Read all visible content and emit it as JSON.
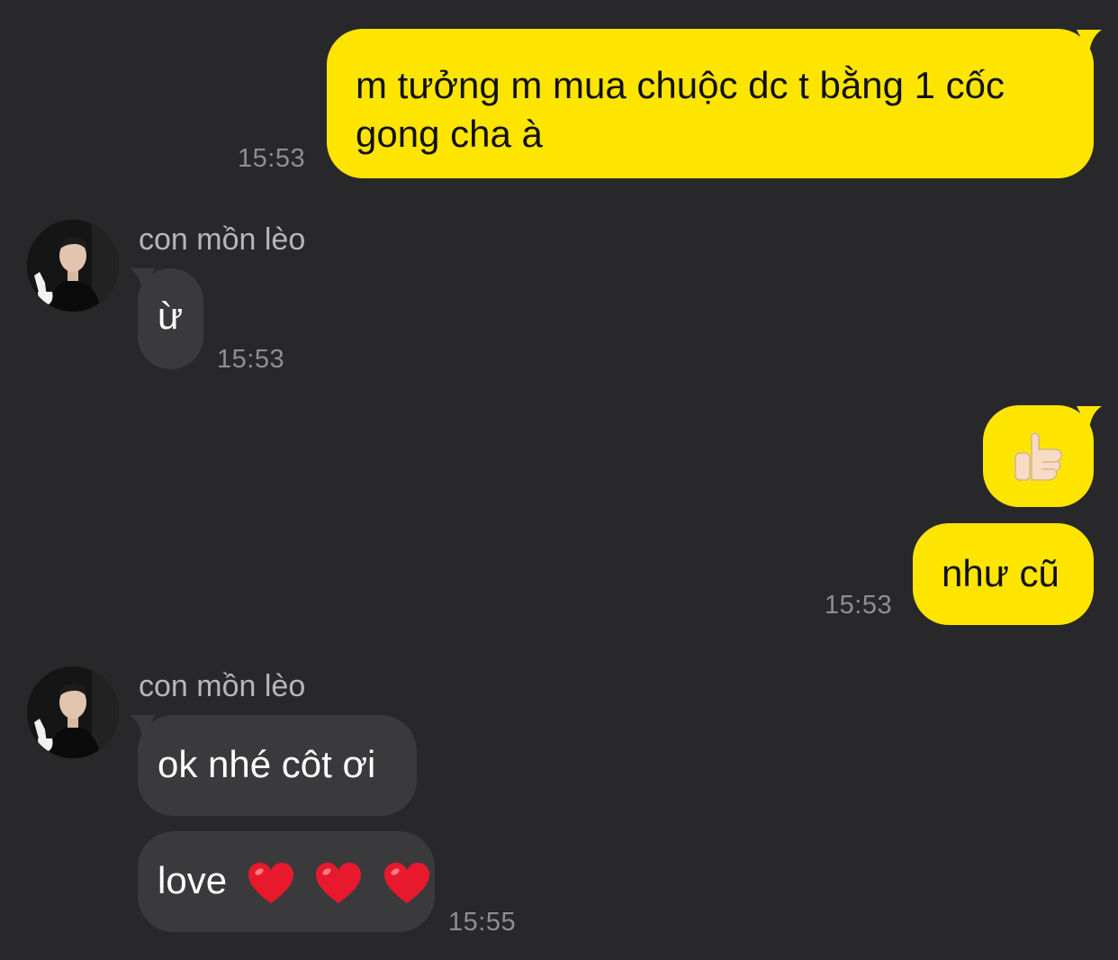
{
  "colors": {
    "background": "#28282a",
    "my_bubble": "#fee500",
    "their_bubble": "#3a3a3c",
    "time_text": "#8e8e93",
    "heart": "#e8192c"
  },
  "messages": {
    "m1": {
      "text": "m tưởng m mua chuộc dc t bằng 1 cốc gong cha à",
      "time": "15:53"
    },
    "sender1": {
      "name": "con mồn lèo",
      "avatar_icon": "user-avatar-icon"
    },
    "m2": {
      "text": "ừ",
      "time": "15:53"
    },
    "m3": {
      "emoji": "👍🏻",
      "icon": "thumbs-up-icon"
    },
    "m4": {
      "text": "như cũ",
      "time": "15:53"
    },
    "sender2": {
      "name": "con mồn lèo",
      "avatar_icon": "user-avatar-icon"
    },
    "m5": {
      "text": "ok nhé côt ơi"
    },
    "m6": {
      "text": "love",
      "emoji_icons": [
        "heart-icon",
        "heart-icon",
        "heart-icon"
      ],
      "time": "15:55"
    }
  }
}
